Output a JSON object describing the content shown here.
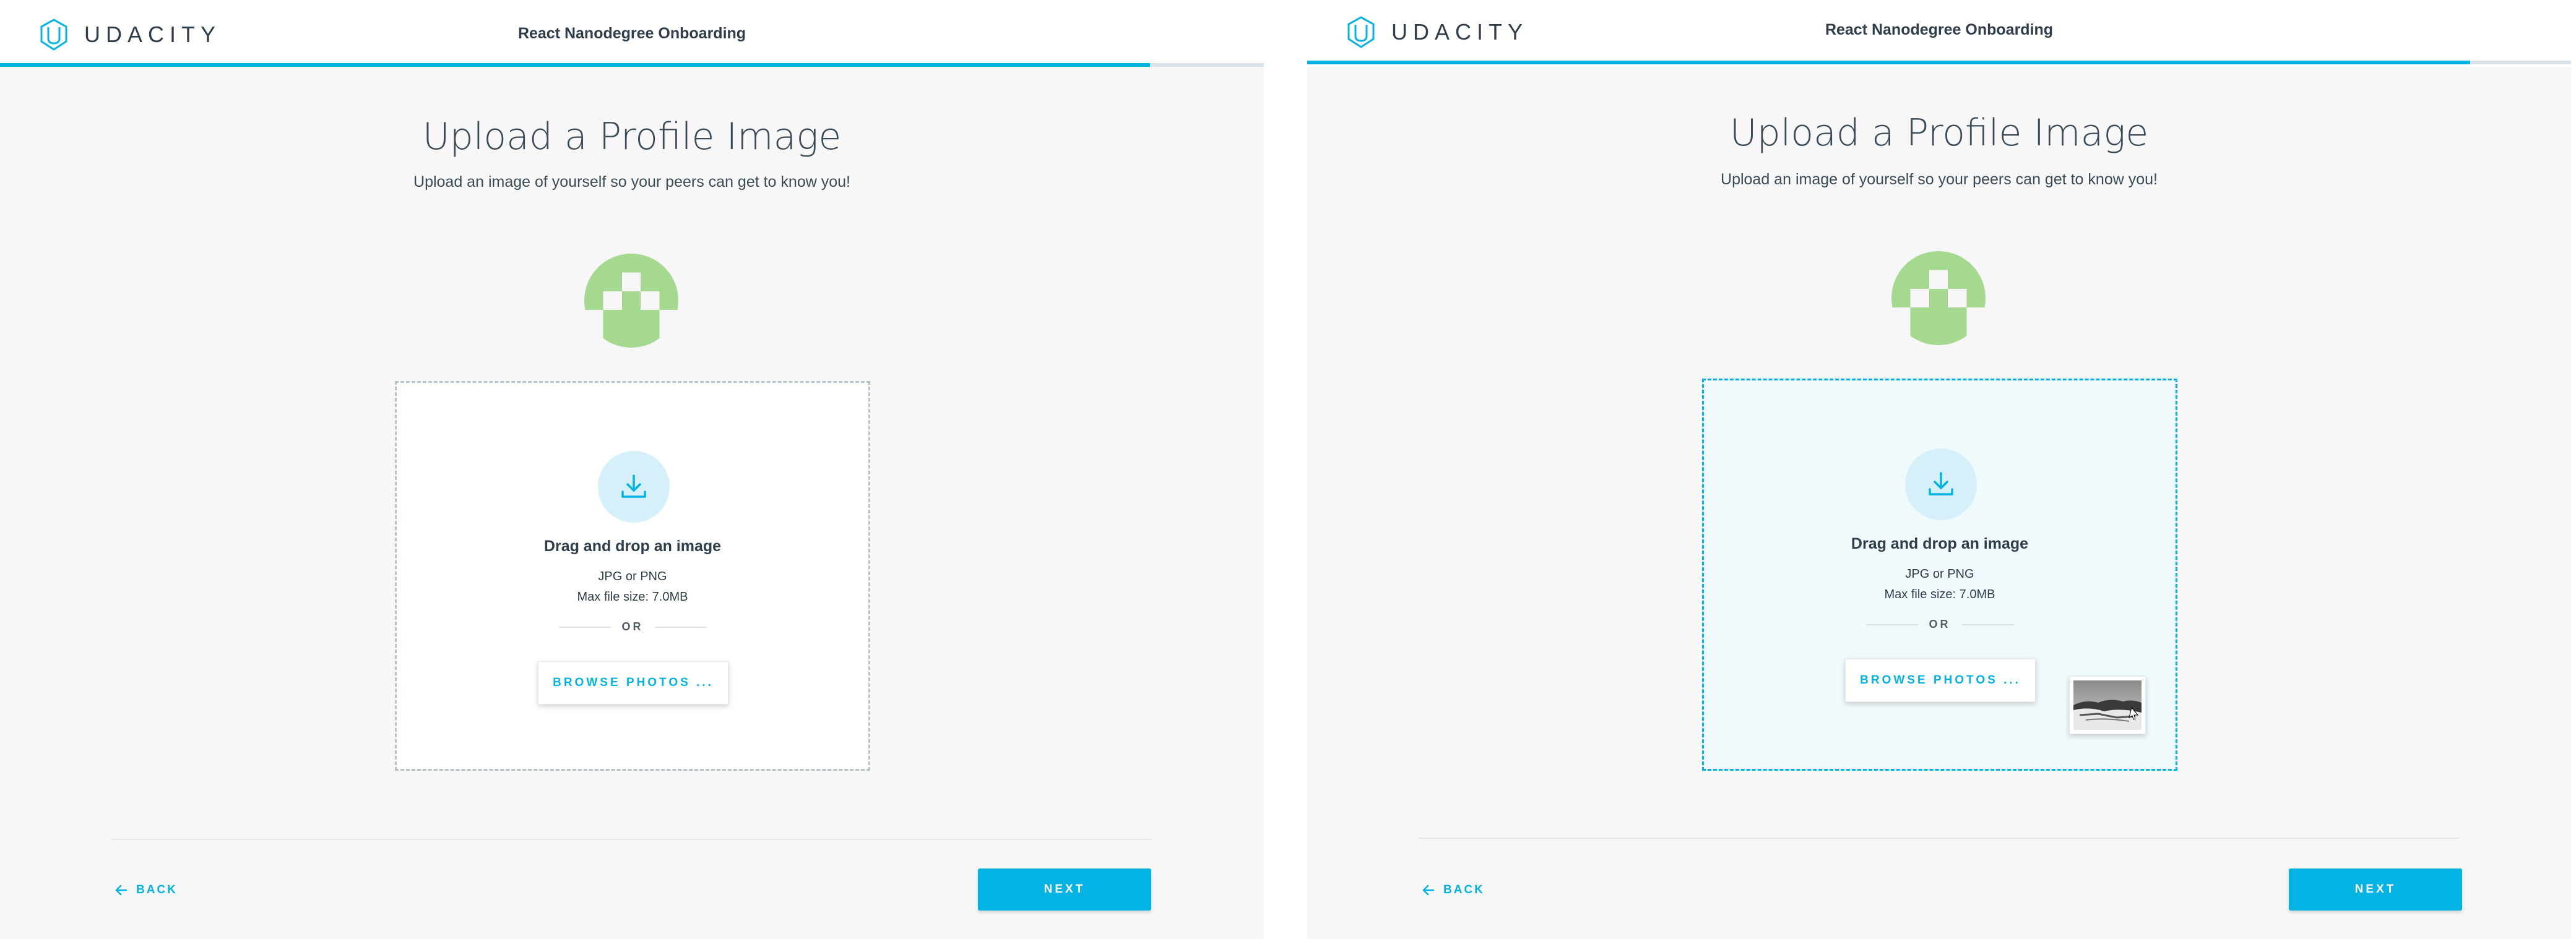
{
  "brand": {
    "wordmark": "UDACITY",
    "icon": "udacity-logo-icon",
    "accent_color": "#02b3e4"
  },
  "header": {
    "title": "React Nanodegree Onboarding"
  },
  "page": {
    "heading": "Upload a Profile Image",
    "subheading": "Upload an image of yourself so your peers can get to know you!"
  },
  "avatar": {
    "icon": "identicon-avatar",
    "color": "#a5d98f"
  },
  "dropzone": {
    "icon": "download-icon",
    "title": "Drag and drop an image",
    "formats": "JPG or PNG",
    "max_size": "Max file size: 7.0MB",
    "or": "OR",
    "browse_label": "BROWSE PHOTOS ..."
  },
  "footer": {
    "back_label": "BACK",
    "next_label": "NEXT"
  },
  "screens": [
    {
      "state": "idle",
      "progress": 0.91
    },
    {
      "state": "dragging-file",
      "progress": 0.92
    }
  ]
}
